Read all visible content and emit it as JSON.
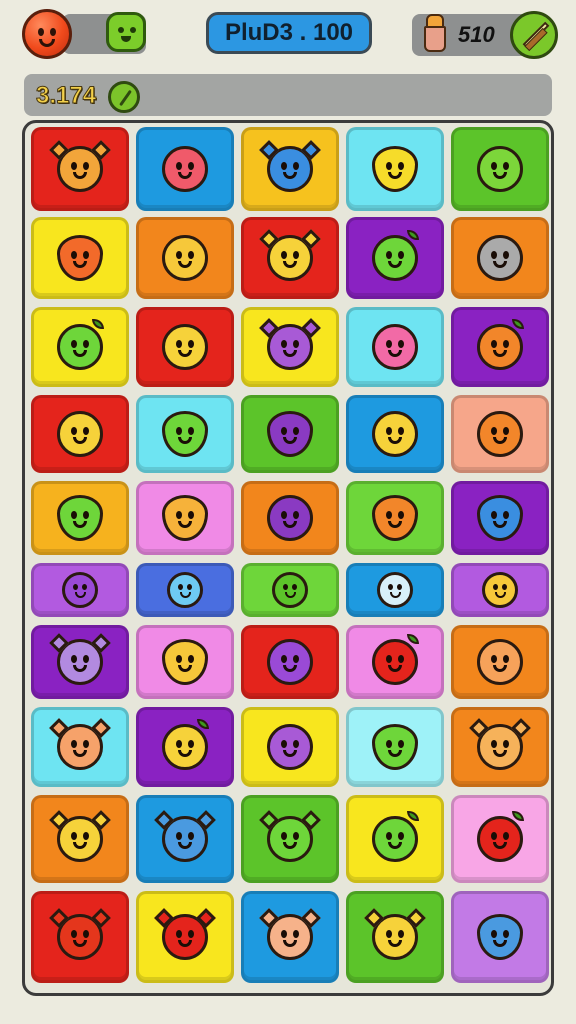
{
  "header": {
    "title": "PluD3 . 100",
    "right_score": "510",
    "left_score": "3.174"
  },
  "board": {
    "rows": [
      {
        "tiles": [
          {
            "bg": "#e4241c",
            "creature": "#f2a53a",
            "shape": "spiky"
          },
          {
            "bg": "#1e9ae0",
            "creature": "#f05a6a",
            "shape": "round"
          },
          {
            "bg": "#f6c21e",
            "creature": "#3a8ee0",
            "shape": "spiky"
          },
          {
            "bg": "#6ee4f2",
            "creature": "#f6dc2a",
            "shape": "drop"
          },
          {
            "bg": "#5cc42a",
            "creature": "#7cd63a",
            "shape": "round"
          }
        ]
      },
      {
        "tiles": [
          {
            "bg": "#f8e61e",
            "creature": "#f26a2a",
            "shape": "drop"
          },
          {
            "bg": "#f2861c",
            "creature": "#f6c83a",
            "shape": "round"
          },
          {
            "bg": "#e4241c",
            "creature": "#f6d23a",
            "shape": "spiky"
          },
          {
            "bg": "#8a22c2",
            "creature": "#6ed63a",
            "shape": "leaf"
          },
          {
            "bg": "#f2861c",
            "creature": "#aaaaaa",
            "shape": "round"
          }
        ]
      },
      {
        "tiles": [
          {
            "bg": "#f8e61e",
            "creature": "#6ed63a",
            "shape": "leaf"
          },
          {
            "bg": "#e4241c",
            "creature": "#f6d23a",
            "shape": "round"
          },
          {
            "bg": "#f8e61e",
            "creature": "#a85ad6",
            "shape": "spiky"
          },
          {
            "bg": "#6ee4f2",
            "creature": "#f26aa6",
            "shape": "round"
          },
          {
            "bg": "#8a22c2",
            "creature": "#f2862a",
            "shape": "leaf"
          }
        ]
      },
      {
        "tiles": [
          {
            "bg": "#e4241c",
            "creature": "#f6d23a",
            "shape": "round"
          },
          {
            "bg": "#6ee4f2",
            "creature": "#6ed63a",
            "shape": "drop"
          },
          {
            "bg": "#5cc42a",
            "creature": "#8a3ac2",
            "shape": "drop"
          },
          {
            "bg": "#1e9ae0",
            "creature": "#f6d23a",
            "shape": "round"
          },
          {
            "bg": "#f6a68a",
            "creature": "#f2862a",
            "shape": "round"
          }
        ]
      },
      {
        "tiles": [
          {
            "bg": "#f6b21e",
            "creature": "#6ed63a",
            "shape": "drop"
          },
          {
            "bg": "#f08ae6",
            "creature": "#f6b23a",
            "shape": "drop"
          },
          {
            "bg": "#f2861c",
            "creature": "#8a3ac2",
            "shape": "round"
          },
          {
            "bg": "#6ed63a",
            "creature": "#f2862a",
            "shape": "drop"
          },
          {
            "bg": "#8a22c2",
            "creature": "#3a8ee0",
            "shape": "drop"
          }
        ]
      },
      {
        "tiles": [
          {
            "bg": "#b25ae0",
            "creature": "#9a4ad6",
            "shape": "small"
          },
          {
            "bg": "#4a6ee0",
            "creature": "#6ecaf2",
            "shape": "small"
          },
          {
            "bg": "#6ed63a",
            "creature": "#5cc42a",
            "shape": "small"
          },
          {
            "bg": "#1e9ae0",
            "creature": "#d8f0f8",
            "shape": "small"
          },
          {
            "bg": "#b25ae0",
            "creature": "#f6c83a",
            "shape": "small"
          }
        ]
      },
      {
        "tiles": [
          {
            "bg": "#8a22c2",
            "creature": "#b28ae0",
            "shape": "spiky"
          },
          {
            "bg": "#f08ae6",
            "creature": "#f6c83a",
            "shape": "drop"
          },
          {
            "bg": "#e4241c",
            "creature": "#9a4ad6",
            "shape": "round"
          },
          {
            "bg": "#f08ae6",
            "creature": "#e4241c",
            "shape": "leaf"
          },
          {
            "bg": "#f2861c",
            "creature": "#f6a25a",
            "shape": "round"
          }
        ]
      },
      {
        "tiles": [
          {
            "bg": "#6ee4f2",
            "creature": "#f6a26a",
            "shape": "spiky"
          },
          {
            "bg": "#8a22c2",
            "creature": "#f6d23a",
            "shape": "leaf"
          },
          {
            "bg": "#f8e61e",
            "creature": "#a85ad6",
            "shape": "round"
          },
          {
            "bg": "#9ef2f8",
            "creature": "#6ed63a",
            "shape": "drop"
          },
          {
            "bg": "#f2861c",
            "creature": "#f6b25a",
            "shape": "spiky"
          }
        ]
      },
      {
        "tiles": [
          {
            "bg": "#f2861c",
            "creature": "#f6d23a",
            "shape": "spiky"
          },
          {
            "bg": "#1e9ae0",
            "creature": "#4a9ae0",
            "shape": "spiky"
          },
          {
            "bg": "#5cc42a",
            "creature": "#6ed63a",
            "shape": "spiky"
          },
          {
            "bg": "#f8e61e",
            "creature": "#6ed63a",
            "shape": "leaf"
          },
          {
            "bg": "#f8a6e6",
            "creature": "#e4241c",
            "shape": "leaf"
          }
        ]
      },
      {
        "tiles": [
          {
            "bg": "#e4241c",
            "creature": "#e4361c",
            "shape": "spiky"
          },
          {
            "bg": "#f8e61e",
            "creature": "#e4241c",
            "shape": "spiky"
          },
          {
            "bg": "#1e9ae0",
            "creature": "#f6b28a",
            "shape": "spiky"
          },
          {
            "bg": "#5cc42a",
            "creature": "#f6d23a",
            "shape": "spiky"
          },
          {
            "bg": "#c27ae6",
            "creature": "#4a9ae0",
            "shape": "drop"
          }
        ]
      }
    ]
  }
}
